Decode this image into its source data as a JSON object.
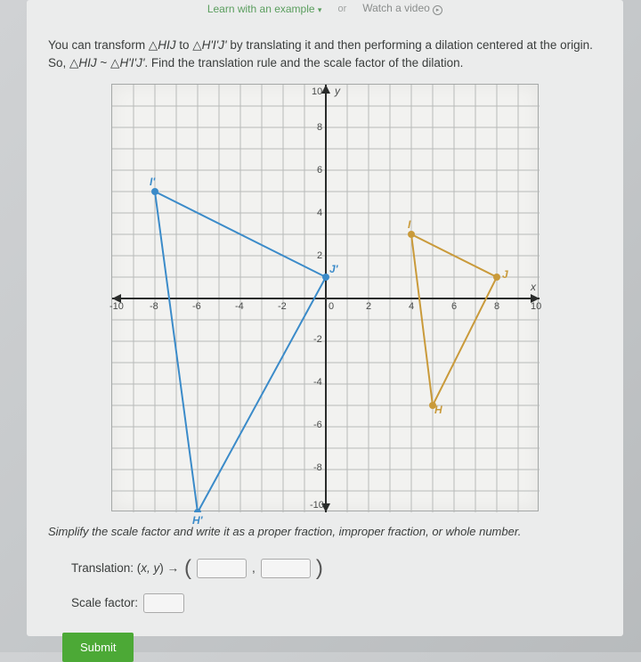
{
  "topLinks": {
    "learn": "Learn with an example",
    "or": "or",
    "watch": "Watch a video"
  },
  "question": {
    "part1": "You can transform △",
    "tri1": "HIJ",
    "part2": " to △",
    "tri2": "H'I'J'",
    "part3": " by translating it and then performing a dilation centered at the origin. So, △",
    "tri3": "HIJ",
    "part4": " ~ △",
    "tri4": "H'I'J'",
    "part5": ". Find the translation rule and the scale factor of the dilation."
  },
  "instruction": "Simplify the scale factor and write it as a proper fraction, improper fraction, or whole number.",
  "answers": {
    "translationLabel": "Translation: (",
    "xyLabel": "x, y",
    "arrow": ") →",
    "comma": ",",
    "scaleFactorLabel": "Scale factor:"
  },
  "submit": "Submit",
  "chart_data": {
    "type": "scatter",
    "xlim": [
      -10,
      10
    ],
    "ylim": [
      -10,
      10
    ],
    "xlabel": "x",
    "ylabel": "y",
    "xticks": [
      -10,
      -8,
      -6,
      -4,
      -2,
      0,
      2,
      4,
      6,
      8,
      10
    ],
    "yticks": [
      -10,
      -8,
      -6,
      -4,
      -2,
      2,
      4,
      6,
      8,
      10
    ],
    "triangles": [
      {
        "name": "HIJ",
        "color": "#c99a3a",
        "points": {
          "H": [
            5,
            -5
          ],
          "I": [
            4,
            3
          ],
          "J": [
            8,
            1
          ]
        }
      },
      {
        "name": "H'I'J'",
        "color": "#3b8bc9",
        "points": {
          "H'": [
            -6,
            -10
          ],
          "I'": [
            -8,
            5
          ],
          "J'": [
            0,
            1
          ]
        }
      }
    ]
  }
}
